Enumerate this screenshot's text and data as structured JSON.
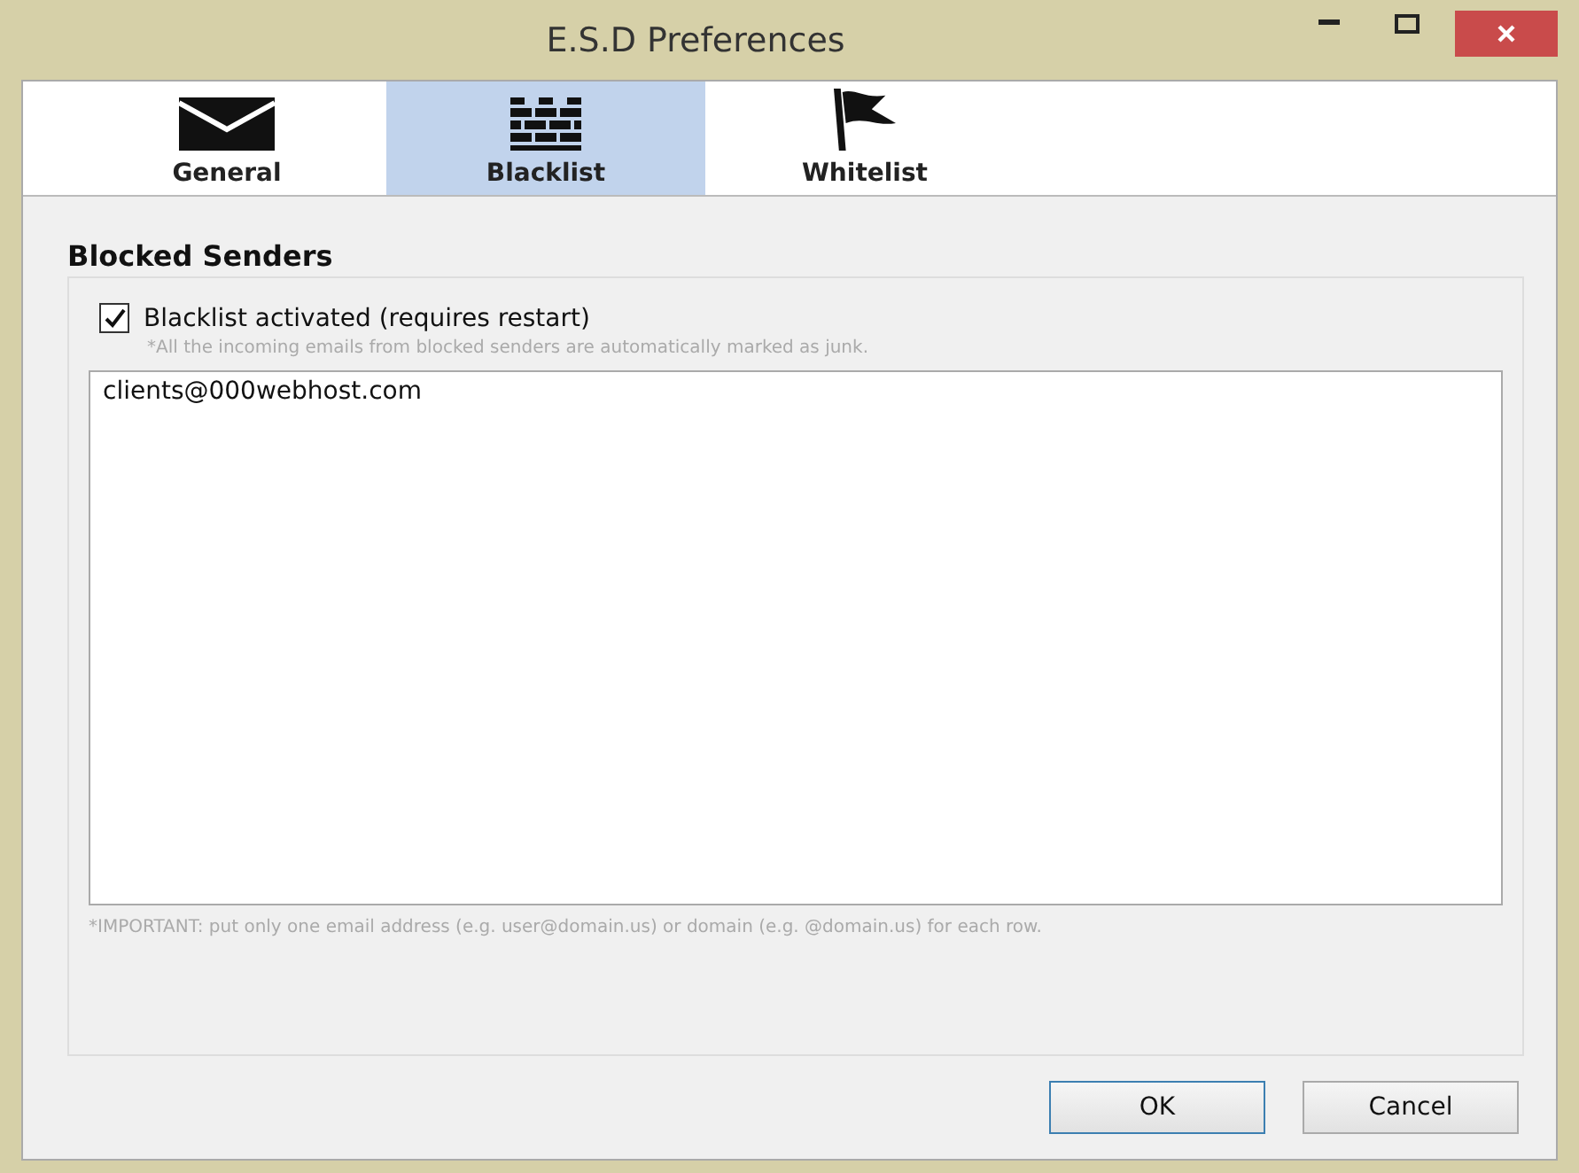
{
  "window": {
    "title": "E.S.D Preferences"
  },
  "tabs": [
    {
      "label": "General",
      "kind": "envelope",
      "selected": false
    },
    {
      "label": "Blacklist",
      "kind": "wall",
      "selected": true
    },
    {
      "label": "Whitelist",
      "kind": "flag",
      "selected": false
    }
  ],
  "group": {
    "title": "Blocked Senders",
    "checkbox": {
      "label": "Blacklist activated (requires restart)",
      "checked": true
    },
    "hint": "*All the incoming emails from blocked senders are automatically marked as junk.",
    "list_value": "clients@000webhost.com",
    "note": "*IMPORTANT: put only one email address (e.g. user@domain.us) or domain (e.g. @domain.us) for each row."
  },
  "buttons": [
    {
      "label": "OK",
      "kind": "default"
    },
    {
      "label": "Cancel",
      "kind": "normal"
    }
  ]
}
